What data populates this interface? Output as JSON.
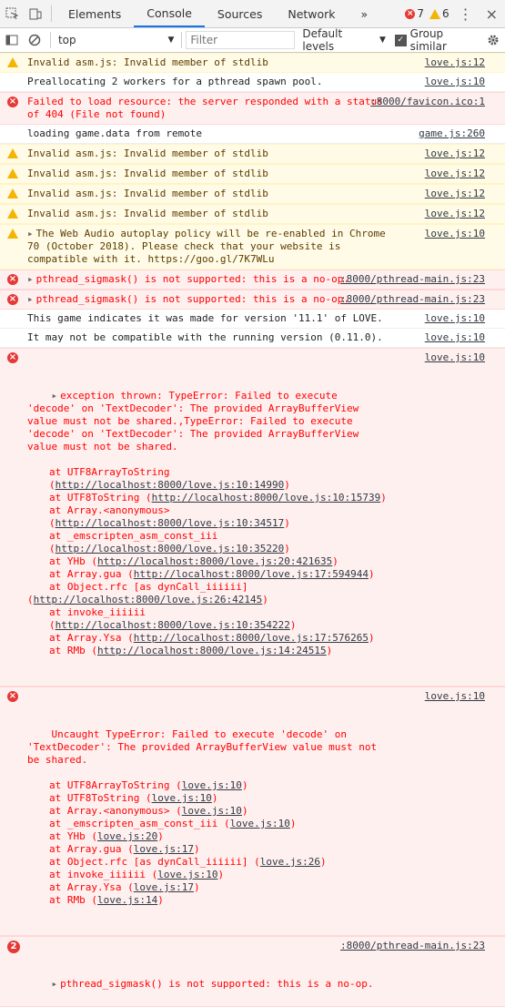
{
  "tabs": [
    "Elements",
    "Console",
    "Sources",
    "Network"
  ],
  "active_tab": "Console",
  "counts": {
    "errors": "7",
    "warnings": "6"
  },
  "toolbar": {
    "context": "top",
    "filter_placeholder": "Filter",
    "levels": "Default levels",
    "group_similar": "Group similar"
  },
  "messages": [
    {
      "type": "warn",
      "text": "Invalid asm.js: Invalid member of stdlib",
      "src": "love.js:12"
    },
    {
      "type": "log",
      "text": "Preallocating 2 workers for a pthread spawn pool.",
      "src": "love.js:10"
    },
    {
      "type": "error",
      "text": "Failed to load resource: the server responded with a status of 404 (File not found)",
      "src": ":8000/favicon.ico:1"
    },
    {
      "type": "log",
      "text": "loading game.data from remote",
      "src": "game.js:260"
    },
    {
      "type": "warn",
      "text": "Invalid asm.js: Invalid member of stdlib",
      "src": "love.js:12"
    },
    {
      "type": "warn",
      "text": "Invalid asm.js: Invalid member of stdlib",
      "src": "love.js:12"
    },
    {
      "type": "warn",
      "text": "Invalid asm.js: Invalid member of stdlib",
      "src": "love.js:12"
    },
    {
      "type": "warn",
      "text": "Invalid asm.js: Invalid member of stdlib",
      "src": "love.js:12"
    },
    {
      "type": "warn",
      "expandable": true,
      "text": "The Web Audio autoplay policy will be re-enabled in Chrome 70 (October 2018). Please check that your website is compatible with it. https://goo.gl/7K7WLu",
      "src": "love.js:10"
    },
    {
      "type": "error",
      "expandable": true,
      "text": "pthread_sigmask() is not supported: this is a no-op.",
      "src": ":8000/pthread-main.js:23"
    },
    {
      "type": "error",
      "expandable": true,
      "text": "pthread_sigmask() is not supported: this is a no-op.",
      "src": ":8000/pthread-main.js:23"
    },
    {
      "type": "log",
      "text": "This game indicates it was made for version '11.1' of LOVE.",
      "src": "love.js:10"
    },
    {
      "type": "log",
      "text": "It may not be compatible with the running version (0.11.0).",
      "src": "love.js:10"
    }
  ],
  "exception": {
    "header": "exception thrown: TypeError: Failed to execute 'decode' on 'TextDecoder': The provided ArrayBufferView value must not be shared.,TypeError: Failed to execute 'decode' on 'TextDecoder': The provided ArrayBufferView value must not be shared.",
    "src": "love.js:10",
    "frames": [
      {
        "pre": "at UTF8ArrayToString (",
        "link": "http://localhost:8000/love.js:10:14990",
        "post": ")"
      },
      {
        "pre": "at UTF8ToString (",
        "link": "http://localhost:8000/love.js:10:15739",
        "post": ")"
      },
      {
        "pre": "at Array.<anonymous> (",
        "link": "http://localhost:8000/love.js:10:34517",
        "post": ")"
      },
      {
        "pre": "at _emscripten_asm_const_iii (",
        "link": "http://localhost:8000/love.js:10:35220",
        "post": ")"
      },
      {
        "pre": "at YHb (",
        "link": "http://localhost:8000/love.js:20:421635",
        "post": ")"
      },
      {
        "pre": "at Array.gua (",
        "link": "http://localhost:8000/love.js:17:594944",
        "post": ")"
      },
      {
        "pre": "at Object.rfc [as dynCall_iiiiii]",
        "link": "",
        "post": ""
      },
      {
        "pre": "(",
        "link": "http://localhost:8000/love.js:26:42145",
        "post": ")",
        "noindent": true
      },
      {
        "pre": "at invoke_iiiiii (",
        "link": "http://localhost:8000/love.js:10:354222",
        "post": ")"
      },
      {
        "pre": "at Array.Ysa (",
        "link": "http://localhost:8000/love.js:17:576265",
        "post": ")"
      },
      {
        "pre": "at RMb (",
        "link": "http://localhost:8000/love.js:14:24515",
        "post": ")"
      }
    ]
  },
  "uncaught": {
    "header": "Uncaught TypeError: Failed to execute 'decode' on 'TextDecoder': The provided ArrayBufferView value must not be shared.",
    "src": "love.js:10",
    "frames": [
      {
        "pre": "at UTF8ArrayToString (",
        "link": "love.js:10",
        "post": ")"
      },
      {
        "pre": "at UTF8ToString (",
        "link": "love.js:10",
        "post": ")"
      },
      {
        "pre": "at Array.<anonymous> (",
        "link": "love.js:10",
        "post": ")"
      },
      {
        "pre": "at _emscripten_asm_const_iii (",
        "link": "love.js:10",
        "post": ")"
      },
      {
        "pre": "at YHb (",
        "link": "love.js:20",
        "post": ")"
      },
      {
        "pre": "at Array.gua (",
        "link": "love.js:17",
        "post": ")"
      },
      {
        "pre": "at Object.rfc [as dynCall_iiiiii] (",
        "link": "love.js:26",
        "post": ")"
      },
      {
        "pre": "at invoke_iiiiii (",
        "link": "love.js:10",
        "post": ")"
      },
      {
        "pre": "at Array.Ysa (",
        "link": "love.js:17",
        "post": ")"
      },
      {
        "pre": "at RMb (",
        "link": "love.js:14",
        "post": ")"
      }
    ]
  },
  "last": {
    "count": "2",
    "text": "pthread_sigmask() is not supported: this is a no-op.",
    "src": ":8000/pthread-main.js:23"
  }
}
